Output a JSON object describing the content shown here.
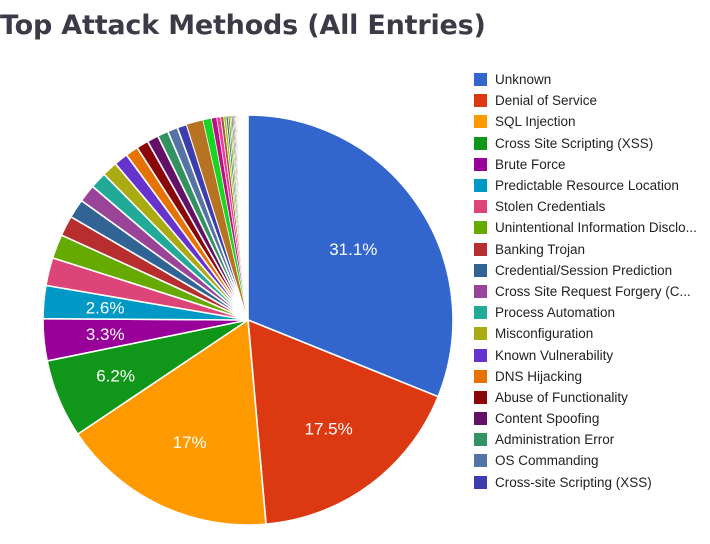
{
  "chart_data": {
    "type": "pie",
    "title": "Top Attack Methods (All Entries)",
    "xlabel": "",
    "ylabel": "",
    "legend_position": "right",
    "grid": false,
    "labels_shown_on_slices": [
      "31.1%",
      "17.5%",
      "17%",
      "6.2%",
      "3.3%",
      "2.6%"
    ],
    "categories": [
      "Unknown",
      "Denial of Service",
      "SQL Injection",
      "Cross Site Scripting (XSS)",
      "Brute Force",
      "Predictable Resource Location",
      "Stolen Credentials",
      "Unintentional Information Disclo...",
      "Banking Trojan",
      "Credential/Session Prediction",
      "Cross Site Request Forgery (C...",
      "Process Automation",
      "Misconfiguration",
      "Known Vulnerability",
      "DNS Hijacking",
      "Abuse of Functionality",
      "Content Spoofing",
      "Administration Error",
      "OS Commanding",
      "Cross-site Scripting (XSS)"
    ],
    "values": [
      31.1,
      17.5,
      17.0,
      6.2,
      3.3,
      2.6,
      2.2,
      1.9,
      1.6,
      1.5,
      1.4,
      1.3,
      1.2,
      1.1,
      1.0,
      0.95,
      0.9,
      0.85,
      0.8,
      0.75
    ],
    "colors": [
      "#3366cc",
      "#dc3912",
      "#ff9900",
      "#109618",
      "#990099",
      "#0099c6",
      "#dd4477",
      "#66aa00",
      "#b82e2e",
      "#316395",
      "#994499",
      "#22aa99",
      "#aaaa11",
      "#6633cc",
      "#e67300",
      "#8b0707",
      "#651067",
      "#329262",
      "#5574a6",
      "#3b3eac"
    ],
    "tail_colors": [
      "#b77322",
      "#16d620",
      "#b91383",
      "#f4359e",
      "#9c5935",
      "#a9c413",
      "#2a778d",
      "#668d1c",
      "#bea413",
      "#0c5922",
      "#743411",
      "#3366cc",
      "#dc3912",
      "#ff9900",
      "#109618",
      "#990099",
      "#0099c6",
      "#dd4477",
      "#66aa00",
      "#b82e2e",
      "#316395",
      "#994499",
      "#22aa99",
      "#aaaa11",
      "#6633cc",
      "#e67300",
      "#8b0707",
      "#651067",
      "#329262",
      "#5574a6",
      "#3b3eac",
      "#b77322",
      "#16d620",
      "#b91383",
      "#f4359e",
      "#9c5935",
      "#a9c413",
      "#2a778d",
      "#668d1c",
      "#bea413"
    ],
    "slice_label_texts": {
      "0": "31.1%",
      "1": "17.5%",
      "2": "17%",
      "3": "6.2%",
      "4": "3.3%",
      "5": "2.6%"
    }
  },
  "legend": {
    "items": [
      {
        "label": "Unknown",
        "color": "#3366cc"
      },
      {
        "label": "Denial of Service",
        "color": "#dc3912"
      },
      {
        "label": "SQL Injection",
        "color": "#ff9900"
      },
      {
        "label": "Cross Site Scripting (XSS)",
        "color": "#109618"
      },
      {
        "label": "Brute Force",
        "color": "#990099"
      },
      {
        "label": "Predictable Resource Location",
        "color": "#0099c6"
      },
      {
        "label": "Stolen Credentials",
        "color": "#dd4477"
      },
      {
        "label": "Unintentional Information Disclo...",
        "color": "#66aa00"
      },
      {
        "label": "Banking Trojan",
        "color": "#b82e2e"
      },
      {
        "label": "Credential/Session Prediction",
        "color": "#316395"
      },
      {
        "label": "Cross Site Request Forgery (C...",
        "color": "#994499"
      },
      {
        "label": "Process Automation",
        "color": "#22aa99"
      },
      {
        "label": "Misconfiguration",
        "color": "#aaaa11"
      },
      {
        "label": "Known Vulnerability",
        "color": "#6633cc"
      },
      {
        "label": "DNS Hijacking",
        "color": "#e67300"
      },
      {
        "label": "Abuse of Functionality",
        "color": "#8b0707"
      },
      {
        "label": "Content Spoofing",
        "color": "#651067"
      },
      {
        "label": "Administration Error",
        "color": "#329262"
      },
      {
        "label": "OS Commanding",
        "color": "#5574a6"
      },
      {
        "label": "Cross-site Scripting (XSS)",
        "color": "#3b3eac"
      }
    ]
  }
}
